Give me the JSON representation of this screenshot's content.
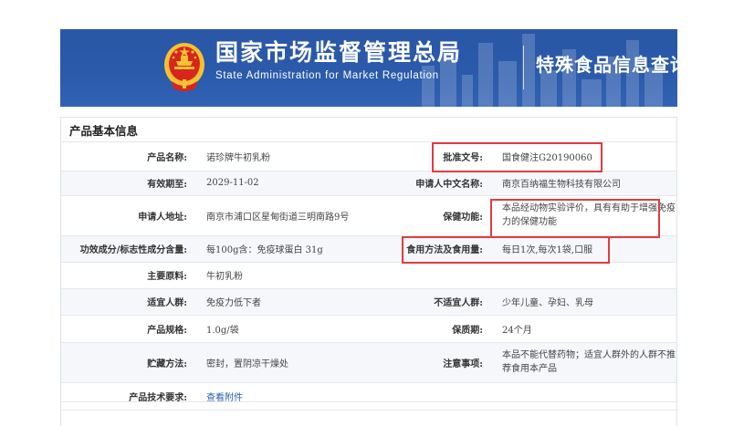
{
  "header": {
    "agency_cn": "国家市场监督管理总局",
    "agency_en": "State Administration  for  Market Regulation",
    "separator": "|",
    "platform": "特殊食品信息查询平台",
    "emblem_icon": "national-emblem-icon",
    "colors": {
      "banner": "#2b5aab",
      "emblem_red": "#d7261e",
      "emblem_gold": "#f5c232"
    }
  },
  "panel": {
    "title": "产品基本信息",
    "rows": [
      {
        "label_left": "产品名称:",
        "value_left": "诺珍牌牛初乳粉",
        "label_right": "批准文号:",
        "value_right": "国食健注G20190060"
      },
      {
        "label_left": "有效期至:",
        "value_left": "2029-11-02",
        "label_right": "申请人中文名称:",
        "value_right": "南京百纳福生物科技有限公司"
      },
      {
        "label_left": "申请人地址:",
        "value_left": "南京市浦口区星甸街道三明南路9号",
        "label_right": "保健功能:",
        "value_right": "本品经动物实验评价，具有有助于增强免疫力的保健功能"
      },
      {
        "label_left": "功效成分/标志性成分含量:",
        "value_left": "每100g含：免疫球蛋白 31g",
        "label_right": "食用方法及食用量:",
        "value_right": "每日1次,每次1袋,口服"
      },
      {
        "label_left": "主要原料:",
        "value_left": "牛初乳粉"
      },
      {
        "label_left": "适宜人群:",
        "value_left": "免疫力低下者",
        "label_right": "不适宜人群:",
        "value_right": "少年儿童、孕妇、乳母"
      },
      {
        "label_left": "产品规格:",
        "value_left": "1.0g/袋",
        "label_right": "保质期:",
        "value_right": "24个月"
      },
      {
        "label_left": "贮藏方法:",
        "value_left": "密封，置阴凉干燥处",
        "label_right": "注意事项:",
        "value_right": "本品不能代替药物；适宜人群外的人群不推荐食用本产品"
      },
      {
        "label_left": "产品技术要求:",
        "value_left": "查看附件"
      }
    ],
    "highlight_color": "#e23b41"
  }
}
